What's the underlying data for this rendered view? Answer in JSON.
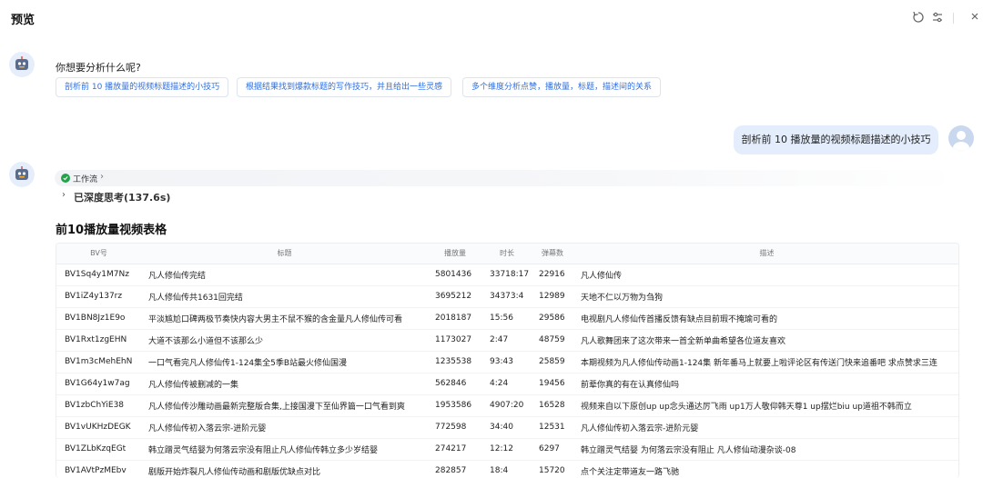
{
  "header": {
    "title": "预览",
    "icons": [
      "refresh-icon",
      "settings-sliders-icon",
      "close-icon"
    ]
  },
  "chat": {
    "question": "你想要分析什么呢?",
    "suggestions": [
      "剖析前 10 播放量的视频标题描述的小技巧",
      "根据结果找到爆款标题的写作技巧，并且给出一些灵感",
      "多个维度分析点赞，播放量，标题，描述间的关系"
    ],
    "user_message": "剖析前 10 播放量的视频标题描述的小技巧",
    "workflow_label": "工作流",
    "thinking_label": "已深度思考(137.6s)",
    "table_title": "前10播放量视频表格"
  },
  "table": {
    "headers": [
      "BV号",
      "标题",
      "播放量",
      "时长",
      "弹幕数",
      "描述"
    ],
    "rows": [
      [
        "BV1Sq4y1M7Nz",
        "凡人修仙传完结",
        "5801436",
        "33718:17",
        "22916",
        "凡人修仙传"
      ],
      [
        "BV1iZ4y137rz",
        "凡人修仙传共1631回完结",
        "3695212",
        "34373:4",
        "12989",
        "天地不仁以万物为刍狗"
      ],
      [
        "BV1BN8Jz1E9o",
        "平淡尴尬口碑两极节奏快内容大男主不鼠不猴的含金量凡人修仙传可看",
        "2018187",
        "15:56",
        "29586",
        "电视剧凡人修仙传首播反馈有缺点目前瑕不掩瑜可看的"
      ],
      [
        "BV1Rxt1zgEHN",
        "大道不该那么小道但不该那么少",
        "1173027",
        "2:47",
        "48759",
        "凡人歌舞团来了这次带来一首全新单曲希望各位道友喜欢"
      ],
      [
        "BV1m3cMehEhN",
        "一口气看完凡人修仙传1-124集全5季B站最火修仙国漫",
        "1235538",
        "93:43",
        "25859",
        "本期视频为凡人修仙传动画1-124集 新年番马上就要上啦评论区有传送门快来追番吧 求点赞求三连"
      ],
      [
        "BV1G64y1w7ag",
        "凡人修仙传被删减的一集",
        "562846",
        "4:24",
        "19456",
        "前辈你真的有在认真修仙吗"
      ],
      [
        "BV1zbChYiE38",
        "凡人修仙传沙雕动画最新完整版合集,上接国漫下至仙界篇一口气看到爽",
        "1953586",
        "4907:20",
        "16528",
        "视频来自以下原创up up念头通达厉飞雨 up1万人敬仰韩天尊1 up摆烂biu up道祖不韩而立"
      ],
      [
        "BV1vUKHzDEGK",
        "凡人修仙传初入落云宗-进阶元婴",
        "772598",
        "34:40",
        "12531",
        "凡人修仙传初入落云宗-进阶元婴"
      ],
      [
        "BV1ZLbKzqEGt",
        "韩立蹭灵气结婴为何落云宗没有阻止凡人修仙传韩立多少岁结婴",
        "274217",
        "12:12",
        "6297",
        "韩立蹭灵气结婴 为何落云宗没有阻止 凡人修仙动漫杂谈-08"
      ],
      [
        "BV1AVtPzMEbv",
        "剧版开始炸裂凡人修仙传动画和剧版优缺点对比",
        "282857",
        "18:4",
        "15720",
        "点个关注定带道友一路飞驰"
      ]
    ]
  }
}
